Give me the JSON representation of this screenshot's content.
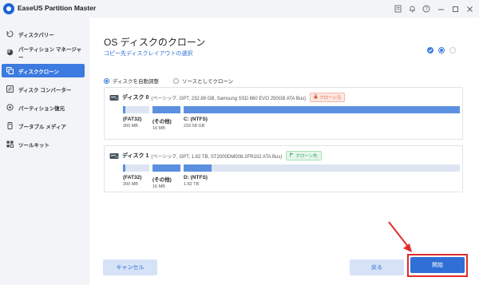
{
  "app": {
    "title": "EaseUS Partition Master"
  },
  "titlebar_icons": [
    "notes-icon",
    "bell-icon",
    "help-icon",
    "minimize-icon",
    "maximize-icon",
    "close-icon"
  ],
  "sidebar": {
    "items": [
      {
        "label": "ディスクパリー",
        "icon": "disk-recovery-icon",
        "active": false
      },
      {
        "label": "パーティション マネージャー",
        "icon": "partition-manager-icon",
        "active": false
      },
      {
        "label": "ディスククローン",
        "icon": "disk-clone-icon",
        "active": true
      },
      {
        "label": "ディスク コンバーター",
        "icon": "disk-converter-icon",
        "active": false
      },
      {
        "label": "パーティション復元",
        "icon": "partition-recovery-icon",
        "active": false
      },
      {
        "label": "ブータブル メディア",
        "icon": "bootable-media-icon",
        "active": false
      },
      {
        "label": "ツールキット",
        "icon": "toolkit-icon",
        "active": false
      }
    ]
  },
  "main": {
    "title": "OS ディスクのクローン",
    "subtitle": "コピー先ディスクレイアウトの選択",
    "options": {
      "auto_adjust": "ディスクを自動調整",
      "as_source": "ソースとしてクローン"
    },
    "disks": [
      {
        "name": "ディスク",
        "number": "0",
        "info": "(ベーシック, GPT, 232.89 GB, Samsung SSD 860 EVO 250GB ATA Bus)",
        "badge": "クローン元",
        "badge_type": "source",
        "partitions": [
          {
            "name": "(FAT32)",
            "size": "300 MB",
            "used": 0.1
          },
          {
            "name": "(その他)",
            "size": "16 MB",
            "used": 1.0
          },
          {
            "name": "C: (NTFS)",
            "size": "232.58 GB",
            "used": 1.0
          }
        ]
      },
      {
        "name": "ディスク",
        "number": "1",
        "info": "(ベーシック, GPT, 1.82 TB, ST2000DM008-2FR102 ATA Bus)",
        "badge": "クローン先",
        "badge_type": "target",
        "partitions": [
          {
            "name": "(FAT32)",
            "size": "300 MB",
            "used": 0.1
          },
          {
            "name": "(その他)",
            "size": "16 MB",
            "used": 1.0
          },
          {
            "name": "D: (NTFS)",
            "size": "1.82 TB",
            "used": 0.1
          }
        ]
      }
    ],
    "buttons": {
      "cancel": "キャンセル",
      "back": "戻る",
      "start": "開始"
    }
  },
  "colors": {
    "accent": "#2f6fd6",
    "sidebar_active": "#3d7be0",
    "highlight": "#e02b2b"
  }
}
